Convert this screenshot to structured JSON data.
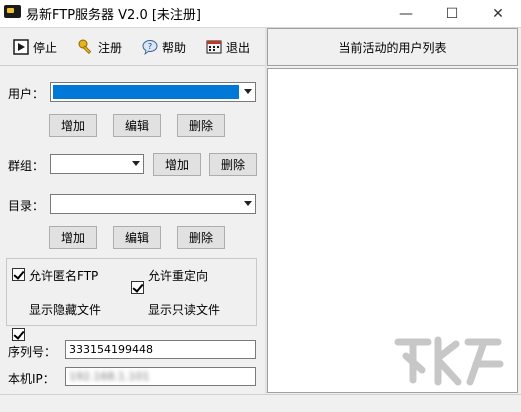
{
  "window": {
    "title": "易新FTP服务器 V2.0 [未注册]"
  },
  "toolbar": {
    "stop": "停止",
    "register": "注册",
    "help": "帮助",
    "exit": "退出"
  },
  "active_list": {
    "header": "当前活动的用户列表"
  },
  "user": {
    "label": "用户："
  },
  "user_buttons": {
    "add": "增加",
    "edit": "编辑",
    "delete": "删除"
  },
  "group": {
    "label": "群组：",
    "add": "增加",
    "delete": "删除"
  },
  "dir": {
    "label": "目录："
  },
  "dir_buttons": {
    "add": "增加",
    "edit": "编辑",
    "delete": "删除"
  },
  "options": {
    "anon": {
      "label": "允许匿名FTP",
      "checked": true
    },
    "redirect": {
      "label": "允许重定向",
      "checked": true
    },
    "hidden": {
      "label": "显示隐藏文件",
      "checked": true
    },
    "readonly": {
      "label": "显示只读文件",
      "checked": true
    }
  },
  "serial": {
    "label": "序列号：",
    "value": "333154199448"
  },
  "ip": {
    "label": "本机IP：",
    "value": "192.168.1.101"
  },
  "icons": {
    "stop": "stop-icon",
    "register": "key-icon",
    "help": "help-icon",
    "exit": "exit-icon"
  }
}
